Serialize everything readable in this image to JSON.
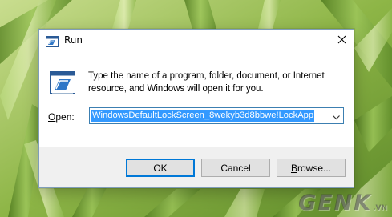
{
  "dialog": {
    "title": "Run",
    "close_glyph": "✕",
    "description": "Type the name of a program, folder, document, or Internet resource, and Windows will open it for you.",
    "open_label_underlined": "O",
    "open_label_rest": "pen:",
    "open_value": "WindowsDefaultLockScreen_8wekyb3d8bbwe!LockApp",
    "buttons": {
      "ok": "OK",
      "cancel": "Cancel",
      "browse_underlined": "B",
      "browse_rest": "rowse..."
    }
  },
  "watermark": {
    "text": "GENK",
    "suffix": ".VN"
  },
  "icons": {
    "title": "run-icon",
    "main": "run-icon",
    "dropdown": "chevron-down-icon",
    "close": "close-icon"
  },
  "colors": {
    "selection": "#3399ff",
    "focus_border": "#0078d7",
    "footer": "#f0f0f0"
  }
}
